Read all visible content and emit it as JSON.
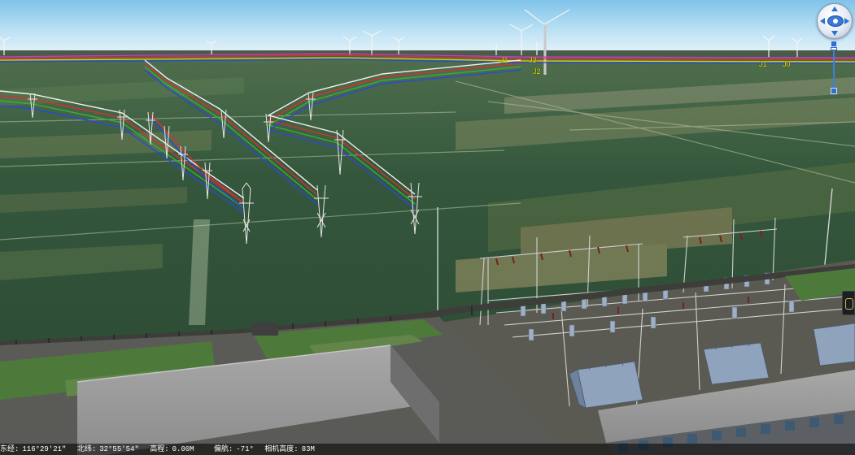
{
  "scene": {
    "tower_labels": [
      {
        "id": "label-j1-far",
        "text": "J1"
      },
      {
        "id": "label-j3",
        "text": "J3"
      },
      {
        "id": "label-j2",
        "text": "J2"
      },
      {
        "id": "label-j1-right",
        "text": "J1"
      },
      {
        "id": "label-j0",
        "text": "J0"
      }
    ]
  },
  "status_bar": {
    "longitude_label": "东经:",
    "longitude": "116°29'21\"",
    "latitude_label": "北纬:",
    "latitude": "32°55'54\"",
    "elevation_label": "高程:",
    "elevation": "0.00M",
    "heading_label": "偏航:",
    "heading": "-71°",
    "camera_height_label": "相机高度:",
    "camera_height": "83M"
  },
  "controls": {
    "navigation": "compass-icon",
    "zoom": "zoom-slider",
    "side_tool": "measure-tool-icon"
  },
  "colors": {
    "line_red": "#d83030",
    "line_green": "#2fb33a",
    "line_blue": "#2a48d8",
    "line_white": "#f0f0f0",
    "label_yellow": "#e8e200"
  }
}
